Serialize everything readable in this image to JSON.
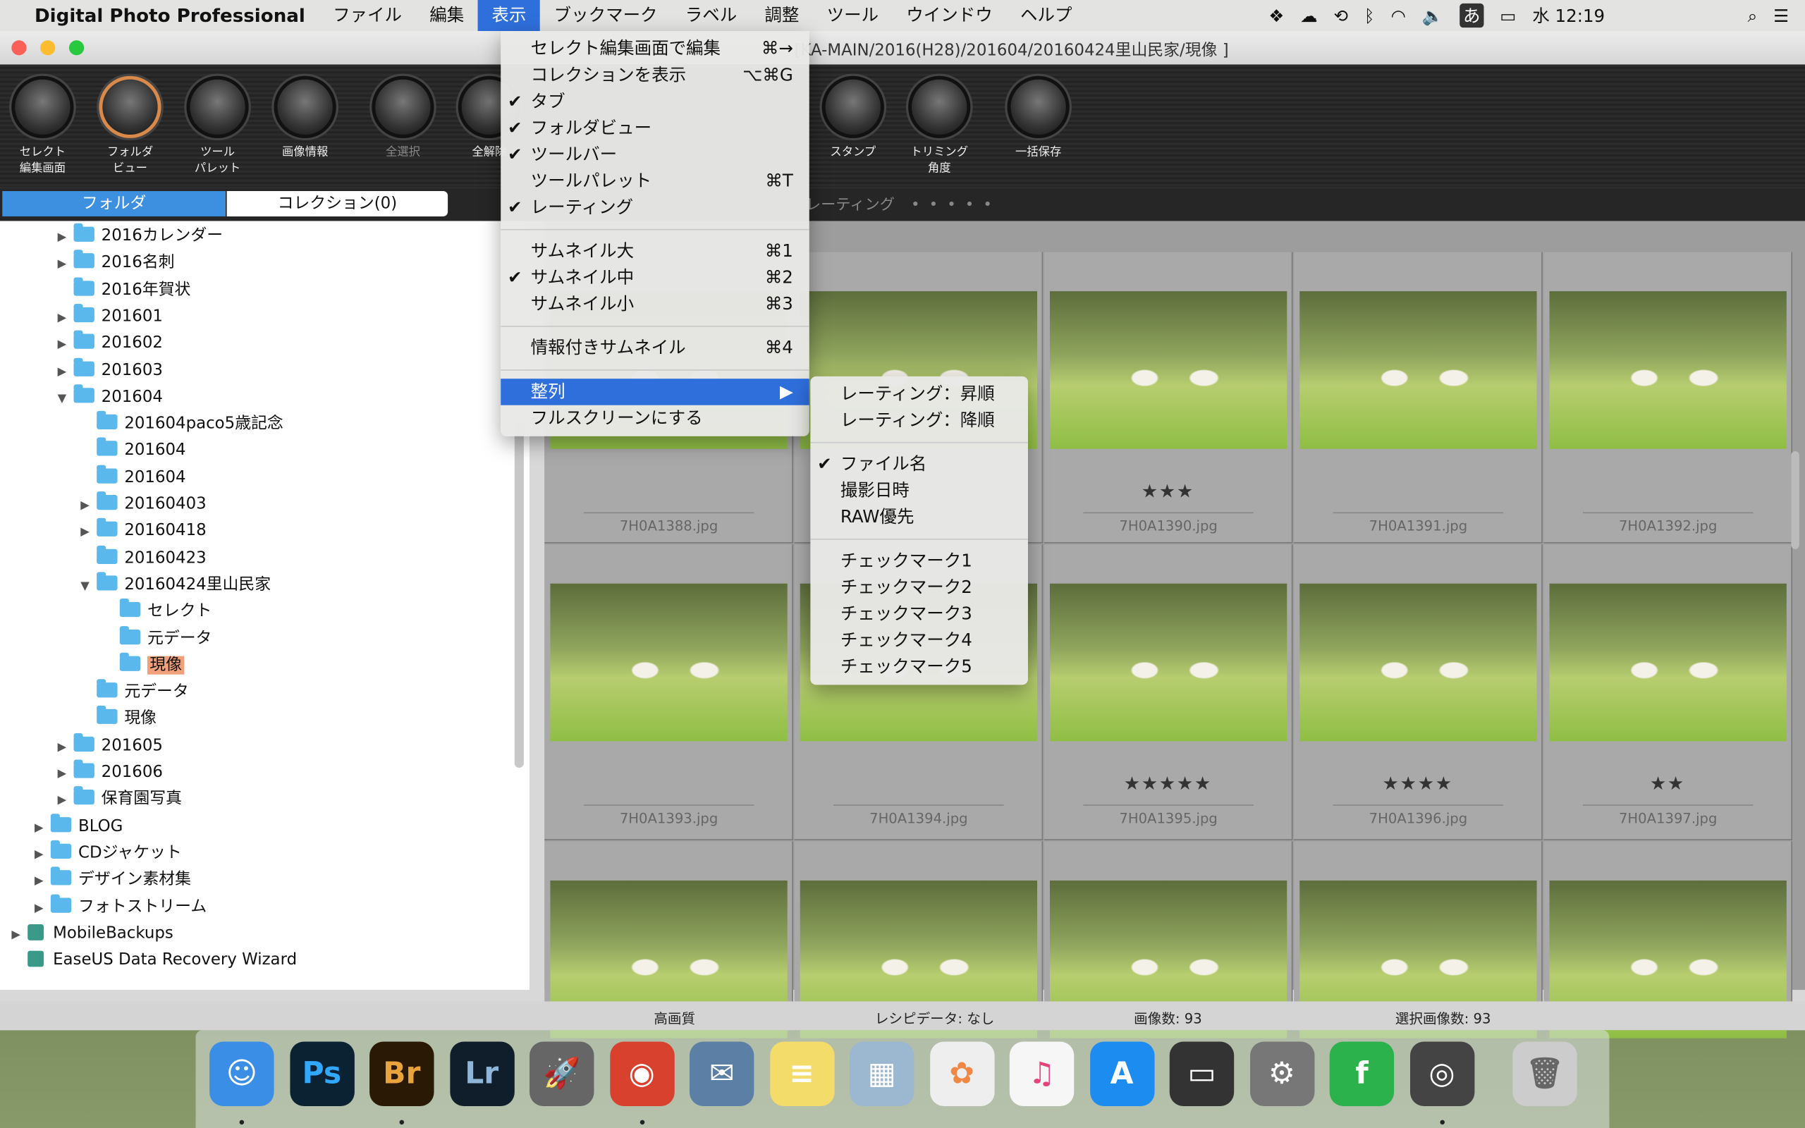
{
  "menubar": {
    "app": "Digital Photo Professional",
    "items": [
      "ファイル",
      "編集",
      "表示",
      "ブックマーク",
      "ラベル",
      "調整",
      "ツール",
      "ウインドウ",
      "ヘルプ"
    ],
    "active": "表示",
    "ime": "あ",
    "clock": "水 12:19"
  },
  "window": {
    "title": "[KA-MAIN/2016(H28)/201604/20160424里山民家/現像 ]"
  },
  "toolbar": [
    {
      "label": "セレクト\n編集画面",
      "icon": "select-edit-icon"
    },
    {
      "label": "フォルダ\nビュー",
      "icon": "folder-view-icon"
    },
    {
      "label": "ツール\nパレット",
      "icon": "tool-palette-icon"
    },
    {
      "label": "画像情報",
      "icon": "info-icon"
    },
    {
      "label": "全選択",
      "icon": "select-all-icon",
      "disabled": true
    },
    {
      "label": "全解除",
      "icon": "deselect-all-icon"
    },
    {
      "label": "スタンプ",
      "icon": "stamp-icon"
    },
    {
      "label": "トリミング\n角度",
      "icon": "trim-angle-icon"
    },
    {
      "label": "一括保存",
      "icon": "batch-save-icon"
    }
  ],
  "tabs": {
    "folder": "フォルダ",
    "collection": "コレクション(0)",
    "rating_label": "レーティング"
  },
  "tree": [
    {
      "label": "2016カレンダー",
      "level": 2,
      "arrow": "▶"
    },
    {
      "label": "2016名刺",
      "level": 2,
      "arrow": "▶"
    },
    {
      "label": "2016年賀状",
      "level": 2,
      "arrow": ""
    },
    {
      "label": "201601",
      "level": 2,
      "arrow": "▶"
    },
    {
      "label": "201602",
      "level": 2,
      "arrow": "▶"
    },
    {
      "label": "201603",
      "level": 2,
      "arrow": "▶"
    },
    {
      "label": "201604",
      "level": 2,
      "arrow": "▼"
    },
    {
      "label": "201604paco5歳記念",
      "level": 3,
      "arrow": ""
    },
    {
      "label": "201604",
      "level": 3,
      "arrow": ""
    },
    {
      "label": "201604",
      "level": 3,
      "arrow": ""
    },
    {
      "label": "20160403",
      "level": 3,
      "arrow": "▶"
    },
    {
      "label": "20160418",
      "level": 3,
      "arrow": "▶"
    },
    {
      "label": "20160423",
      "level": 3,
      "arrow": ""
    },
    {
      "label": "20160424里山民家",
      "level": 3,
      "arrow": "▼"
    },
    {
      "label": "セレクト",
      "level": 4,
      "arrow": ""
    },
    {
      "label": "元データ",
      "level": 4,
      "arrow": ""
    },
    {
      "label": "現像",
      "level": 4,
      "arrow": "",
      "selected": true
    },
    {
      "label": "元データ",
      "level": 3,
      "arrow": ""
    },
    {
      "label": "現像",
      "level": 3,
      "arrow": ""
    },
    {
      "label": "201605",
      "level": 2,
      "arrow": "▶"
    },
    {
      "label": "201606",
      "level": 2,
      "arrow": "▶"
    },
    {
      "label": "保育園写真",
      "level": 2,
      "arrow": "▶"
    },
    {
      "label": "BLOG",
      "level": 1,
      "arrow": "▶"
    },
    {
      "label": "CDジャケット",
      "level": 1,
      "arrow": "▶"
    },
    {
      "label": "デザイン素材集",
      "level": 1,
      "arrow": "▶"
    },
    {
      "label": "フォトストリーム",
      "level": 1,
      "arrow": "▶"
    },
    {
      "label": "MobileBackups",
      "level": 0,
      "arrow": "▶",
      "drive": true
    },
    {
      "label": "EaseUS Data Recovery Wizard",
      "level": 0,
      "arrow": "",
      "drive": true
    }
  ],
  "thumbnails": [
    {
      "file": "7H0A1388.jpg",
      "stars": 0
    },
    {
      "file": "",
      "stars": 0
    },
    {
      "file": "7H0A1390.jpg",
      "stars": 3
    },
    {
      "file": "7H0A1391.jpg",
      "stars": 0
    },
    {
      "file": "7H0A1392.jpg",
      "stars": 0
    },
    {
      "file": "7H0A1393.jpg",
      "stars": 0
    },
    {
      "file": "7H0A1394.jpg",
      "stars": 0
    },
    {
      "file": "7H0A1395.jpg",
      "stars": 5
    },
    {
      "file": "7H0A1396.jpg",
      "stars": 4
    },
    {
      "file": "7H0A1397.jpg",
      "stars": 2
    },
    {
      "file": "",
      "stars": 0
    },
    {
      "file": "",
      "stars": 0
    },
    {
      "file": "",
      "stars": 0
    },
    {
      "file": "",
      "stars": 0
    },
    {
      "file": "",
      "stars": 0
    }
  ],
  "status": {
    "quality": "高画質",
    "recipe": "レシピデータ: なし",
    "count": "画像数: 93",
    "selected": "選択画像数: 93"
  },
  "view_menu": [
    {
      "label": "セレクト編集画面で編集",
      "shortcut": "⌘→"
    },
    {
      "label": "コレクションを表示",
      "shortcut": "⌥⌘G"
    },
    {
      "label": "タブ",
      "checked": true
    },
    {
      "label": "フォルダビュー",
      "checked": true
    },
    {
      "label": "ツールバー",
      "checked": true
    },
    {
      "label": "ツールパレット",
      "shortcut": "⌘T"
    },
    {
      "label": "レーティング",
      "checked": true
    },
    {
      "sep": true
    },
    {
      "label": "サムネイル大",
      "shortcut": "⌘1"
    },
    {
      "label": "サムネイル中",
      "shortcut": "⌘2",
      "checked": true
    },
    {
      "label": "サムネイル小",
      "shortcut": "⌘3"
    },
    {
      "sep": true
    },
    {
      "label": "情報付きサムネイル",
      "shortcut": "⌘4"
    },
    {
      "sep": true
    },
    {
      "label": "整列",
      "shortcut": "▶",
      "highlighted": true
    },
    {
      "label": "フルスクリーンにする"
    }
  ],
  "sort_menu": [
    {
      "label": "レーティング：昇順"
    },
    {
      "label": "レーティング：降順"
    },
    {
      "sep": true
    },
    {
      "label": "ファイル名",
      "checked": true
    },
    {
      "label": "撮影日時"
    },
    {
      "label": "RAW優先"
    },
    {
      "sep": true
    },
    {
      "label": "チェックマーク1"
    },
    {
      "label": "チェックマーク2"
    },
    {
      "label": "チェックマーク3"
    },
    {
      "label": "チェックマーク4"
    },
    {
      "label": "チェックマーク5"
    }
  ],
  "dock": [
    {
      "name": "finder",
      "label": "☺",
      "color": "#3a8ee6"
    },
    {
      "name": "photoshop",
      "label": "Ps",
      "color": "#0b2233",
      "fg": "#31a8ff"
    },
    {
      "name": "bridge",
      "label": "Br",
      "color": "#2a1a05",
      "fg": "#e8a33a"
    },
    {
      "name": "lightroom",
      "label": "Lr",
      "color": "#0f1e2a",
      "fg": "#8fb5d8"
    },
    {
      "name": "launchpad",
      "label": "🚀",
      "color": "#666"
    },
    {
      "name": "chrome",
      "label": "◉",
      "color": "#d9412f"
    },
    {
      "name": "mail-bird",
      "label": "✉",
      "color": "#5c7fa6"
    },
    {
      "name": "notes",
      "label": "≡",
      "color": "#f4dc6a"
    },
    {
      "name": "preview",
      "label": "▦",
      "color": "#9cb7d0"
    },
    {
      "name": "photos",
      "label": "✿",
      "color": "#eee",
      "fg": "#e84"
    },
    {
      "name": "itunes",
      "label": "♫",
      "color": "#f6f6f6",
      "fg": "#e4447a"
    },
    {
      "name": "app-store",
      "label": "A",
      "color": "#1d8cf0"
    },
    {
      "name": "screen-capture",
      "label": "▭",
      "color": "#333"
    },
    {
      "name": "system-preferences",
      "label": "⚙",
      "color": "#777"
    },
    {
      "name": "feedly",
      "label": "f",
      "color": "#2bb24c"
    },
    {
      "name": "digital-photo-professional",
      "label": "◎",
      "color": "#444"
    },
    {
      "name": "trash",
      "label": "🗑",
      "color": "#ccc",
      "fg": "#666"
    }
  ],
  "colors": {
    "accent": "#2f6fdc",
    "selected_folder": "#f2a07a",
    "folder": "#5bb8ec"
  }
}
